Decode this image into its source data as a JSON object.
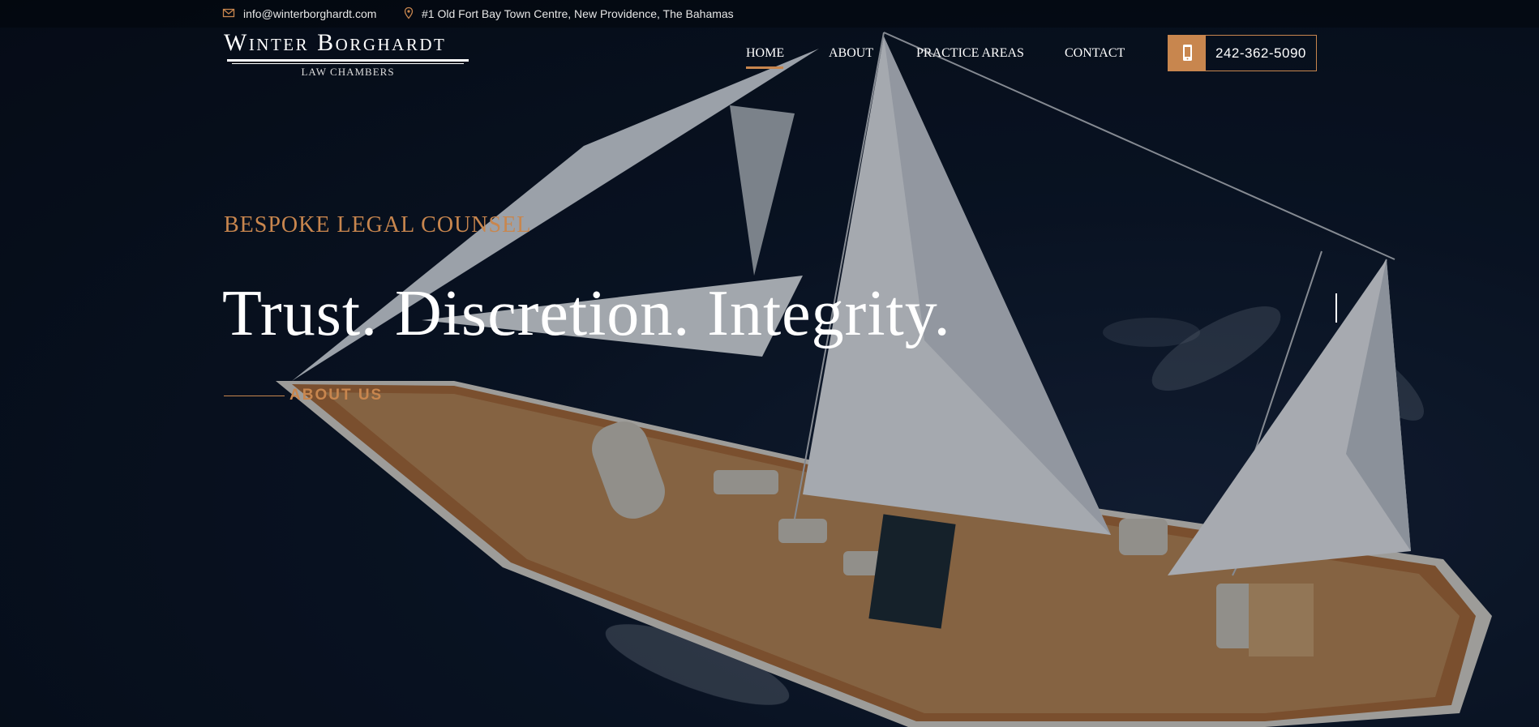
{
  "topbar": {
    "email": "info@winterborghardt.com",
    "address": "#1 Old Fort Bay Town Centre, New Providence, The Bahamas",
    "email_icon": "envelope-icon",
    "address_icon": "map-pin-icon"
  },
  "brand": {
    "name": "Winter Borghardt",
    "subtitle": "LAW CHAMBERS"
  },
  "nav": {
    "items": [
      {
        "label": "HOME",
        "active": true
      },
      {
        "label": "ABOUT",
        "active": false
      },
      {
        "label": "PRACTICE AREAS",
        "active": false
      },
      {
        "label": "CONTACT",
        "active": false
      }
    ],
    "phone": {
      "number": "242-362-5090",
      "icon": "mobile-phone-icon"
    }
  },
  "hero": {
    "eyebrow": "BESPOKE LEGAL COUNSEL",
    "headline": "Trust. Discretion. Integrity.",
    "cta_label": "ABOUT US",
    "background": "aerial-sailing-yacht-photo"
  },
  "colors": {
    "accent": "#c8864e",
    "text": "#ffffff",
    "background": "#0a1220"
  }
}
